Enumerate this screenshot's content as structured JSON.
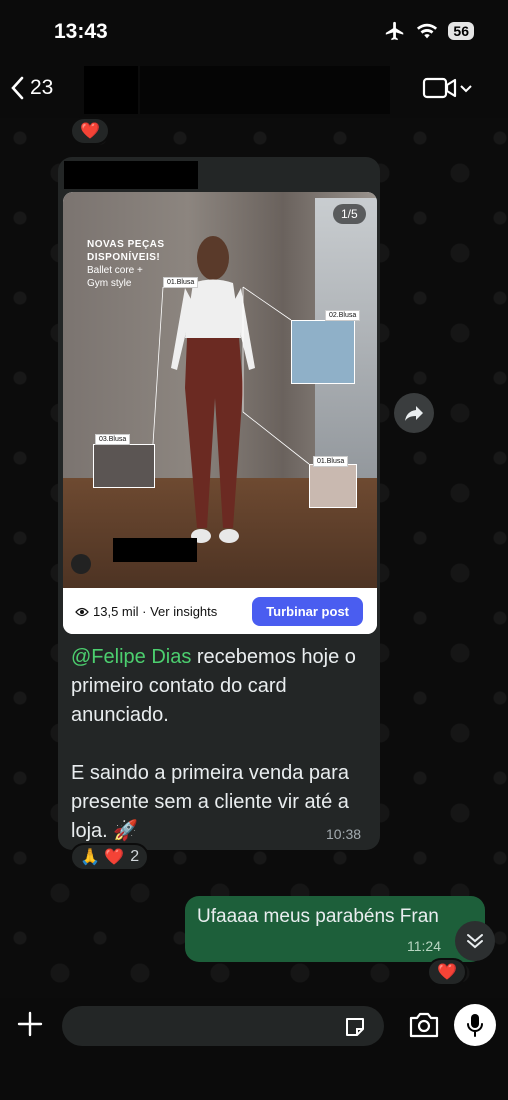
{
  "status": {
    "time": "13:43",
    "battery": "56"
  },
  "header": {
    "back_count": "23"
  },
  "messages": {
    "prev_reaction": "❤️",
    "post": {
      "counter": "1/5",
      "promo_line1": "NOVAS PEÇAS",
      "promo_line2": "DISPONÍVEIS!",
      "promo_line3": "Ballet core +",
      "promo_line4": "Gym style",
      "tags": [
        "01.Blusa",
        "02.Blusa",
        "03.Blusa",
        "01.Blusa"
      ],
      "views": "13,5 mil · Ver insights",
      "boost_label": "Turbinar post"
    },
    "incoming": {
      "mention": "@Felipe Dias",
      "text_part1": " recebemos hoje o primeiro contato do card anunciado.",
      "text_part2": "E saindo a primeira venda para presente sem a cliente vir até a loja. 🚀",
      "time": "10:38",
      "reactions": "🙏 ❤️",
      "reaction_count": "2"
    },
    "outgoing": {
      "text": "Ufaaaa meus parabéns Fran",
      "time": "11:24",
      "reaction": "❤️"
    }
  },
  "colors": {
    "accent_green": "#4ccf6f",
    "out_bubble": "#1d5f3a",
    "in_bubble": "#232626",
    "boost": "#4a5df0"
  }
}
